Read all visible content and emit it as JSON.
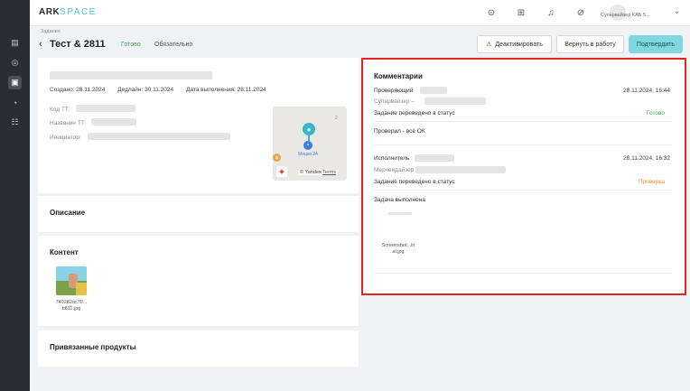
{
  "app": {
    "logo_part1": "ARK",
    "logo_part2": "SPACE",
    "user_name": "Супервайзер КАБ 5..."
  },
  "breadcrumb": "Задания",
  "header": {
    "title": "Тест & 2811",
    "status": "Готово",
    "required": "Обязательно"
  },
  "actions": {
    "deactivate": "Деактивировать",
    "return": "Вернуть в работу",
    "confirm": "Подтвердить"
  },
  "task": {
    "created": "Создано: 28.11.2024",
    "deadline": "Дедлайн: 30.11.2024",
    "done_date": "Дата выполнения: 28.11.2024",
    "code_label": "Код ТТ:",
    "name_label": "Название ТТ:",
    "initiator_label": "Инициатор:"
  },
  "map": {
    "place": "Моцка 24",
    "copyright": "© Yandex",
    "terms": "Terms",
    "number": "2"
  },
  "sections": {
    "description": "Описание",
    "content": "Контент",
    "products": "Привязанные продукты"
  },
  "content_file": {
    "line1": "740282ac79...",
    "line2": "b811.jpg"
  },
  "comments": {
    "title": "Комментарии",
    "items": [
      {
        "role": "Проверяющий",
        "sub": "Супервайзер –",
        "date": "28.11.2024, 16:44",
        "status_text": "Задание переведено в статус",
        "status": "Готово",
        "message": "Проверил - всё ОК"
      },
      {
        "role": "Исполнитель",
        "sub": "Мерчендайзер",
        "date": "28.11.2024, 16:32",
        "status_text": "Задание переведено в статус",
        "status": "Проверка",
        "message": "Задача выполнена",
        "file_line1": "Screenshot...in",
        "file_line2": "al.jpg"
      }
    ]
  },
  "colors": {
    "accent": "#7fd7e0",
    "status_ok": "#3aa856",
    "status_check": "#f08c2a",
    "highlight": "#e0241f"
  },
  "icons": [
    "dashboard-icon",
    "database-icon",
    "tasks-icon",
    "target-icon",
    "settings-icon",
    "chat-icon",
    "grid-icon",
    "bell-icon",
    "compass-icon",
    "warning-icon"
  ]
}
